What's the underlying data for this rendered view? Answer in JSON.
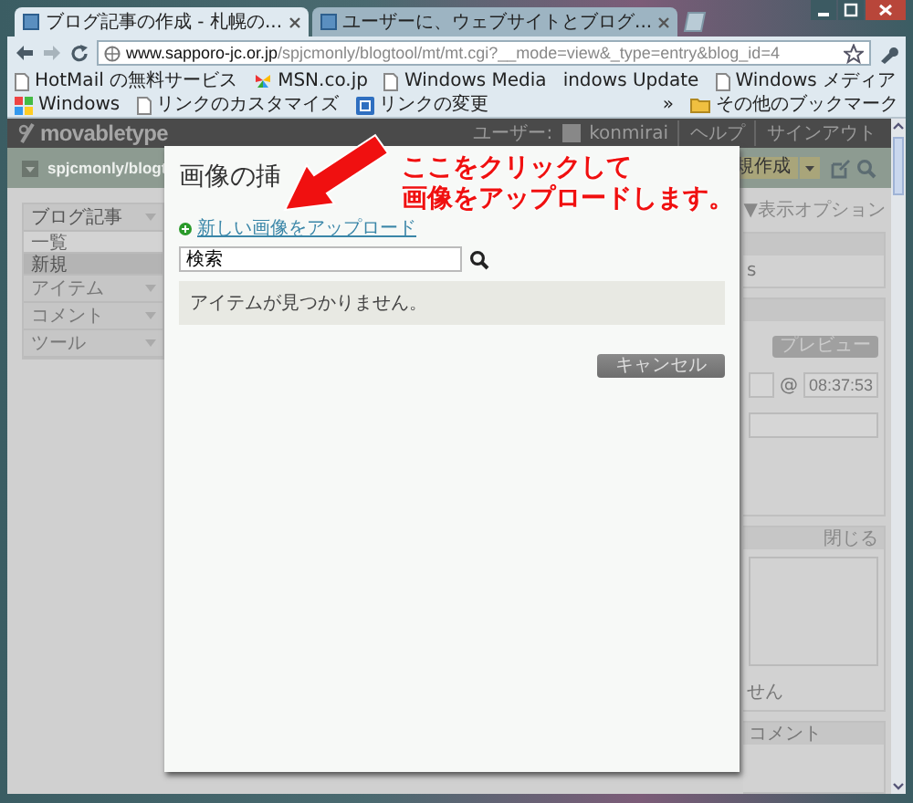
{
  "browser": {
    "tabs": [
      {
        "title": "ブログ記事の作成 - 札幌の...",
        "selected": true
      },
      {
        "title": "ユーザーに、ウェブサイトとブログ...",
        "selected": false
      }
    ],
    "address": {
      "host": "www.sapporo-jc.or.jp",
      "path": "/spjcmonly/blogtool/mt/mt.cgi?__mode=view&_type=entry&blog_id=4"
    },
    "bookmarks": [
      {
        "label": "HotMail の無料サービス",
        "kind": "page"
      },
      {
        "label": "MSN.co.jp",
        "kind": "msn"
      },
      {
        "label": "Windows Media",
        "kind": "page"
      },
      {
        "label": "indows Update",
        "kind": "none"
      },
      {
        "label": "Windows メディア",
        "kind": "page"
      },
      {
        "label": "Windows",
        "kind": "windows"
      },
      {
        "label": "リンクのカスタマイズ",
        "kind": "page"
      },
      {
        "label": "リンクの変更",
        "kind": "app"
      }
    ],
    "overflow": "»",
    "other_bookmarks": "その他のブックマーク"
  },
  "app": {
    "logo": "movabletype",
    "user_label": "ユーザー:",
    "user": "konmirai",
    "links": [
      "ヘルプ",
      "サインアウト"
    ],
    "blog_name": "spjcmonly/blogt",
    "new_button": "規作成",
    "menu": [
      {
        "label": "ブログ記事",
        "kind": "group",
        "selected": false
      },
      {
        "label": "一覧",
        "kind": "sub",
        "selected": false
      },
      {
        "label": "新規",
        "kind": "sub",
        "selected": true
      },
      {
        "label": "アイテム",
        "kind": "group",
        "selected": false
      },
      {
        "label": "コメント",
        "kind": "group",
        "selected": false
      },
      {
        "label": "ツール",
        "kind": "group",
        "selected": false
      }
    ],
    "display_options": "▼表示オプション",
    "panels": [
      {
        "kind": "text",
        "text": "s"
      },
      {
        "kind": "publish",
        "button": "プレビュー",
        "at": "@",
        "time": "08:37:53"
      },
      {
        "kind": "notes",
        "action": "閉じる",
        "text": "せん"
      },
      {
        "kind": "header",
        "title": "コメント"
      }
    ]
  },
  "dialog": {
    "title": "画像の挿",
    "upload_link": "新しい画像をアップロード",
    "search_value": "検索",
    "message": "アイテムが見つかりません。",
    "cancel": "キャンセル"
  },
  "annotation": {
    "lines": [
      "ここをクリックして",
      "画像をアップロードします。"
    ]
  }
}
